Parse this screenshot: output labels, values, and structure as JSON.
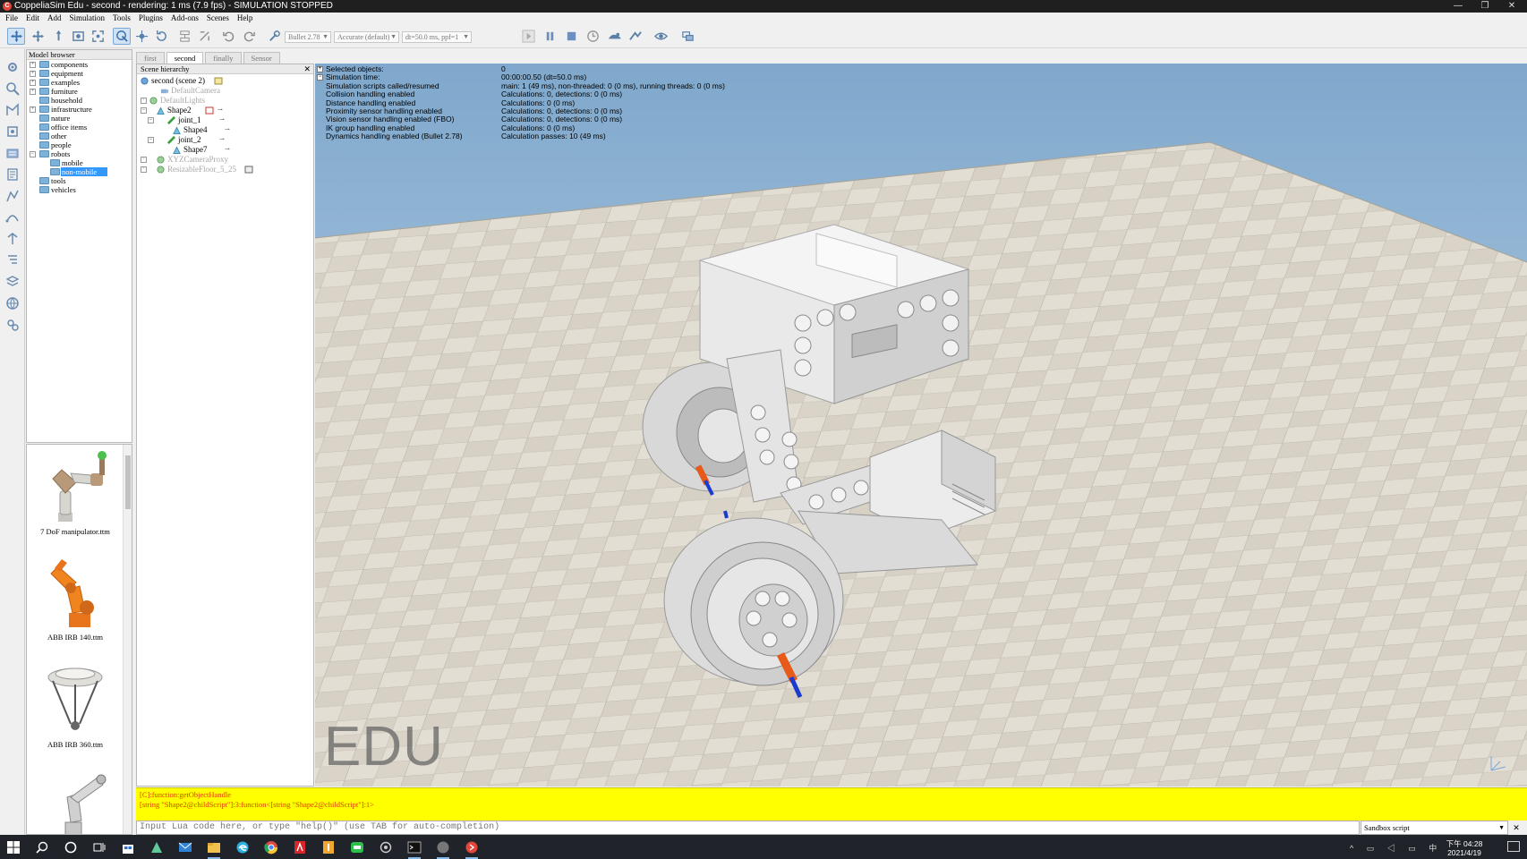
{
  "window": {
    "title": "CoppeliaSim Edu - second - rendering: 1 ms (7.9 fps) - SIMULATION STOPPED",
    "app_icon_letter": "C",
    "controls": {
      "minimize": "—",
      "restore": "❐",
      "close": "✕"
    }
  },
  "menu": [
    "File",
    "Edit",
    "Add",
    "Simulation",
    "Tools",
    "Plugins",
    "Add-ons",
    "Scenes",
    "Help"
  ],
  "toolbar": {
    "engine": "Bullet 2.78",
    "accuracy": "Accurate (default)",
    "timestep": "dt=50.0 ms, ppf=1"
  },
  "model_browser": {
    "header": "Model browser",
    "items": [
      {
        "label": "components",
        "expandable": true
      },
      {
        "label": "equipment",
        "expandable": true
      },
      {
        "label": "examples",
        "expandable": true
      },
      {
        "label": "furniture",
        "expandable": true
      },
      {
        "label": "household",
        "expandable": false
      },
      {
        "label": "infrastructure",
        "expandable": true
      },
      {
        "label": "nature",
        "expandable": false
      },
      {
        "label": "office items",
        "expandable": false
      },
      {
        "label": "other",
        "expandable": false
      },
      {
        "label": "people",
        "expandable": false
      },
      {
        "label": "robots",
        "expandable": true,
        "expanded": true
      },
      {
        "label": "mobile",
        "level": 1
      },
      {
        "label": "non-mobile",
        "level": 1,
        "selected": true
      },
      {
        "label": "tools",
        "expandable": false
      },
      {
        "label": "vehicles",
        "expandable": false
      }
    ],
    "thumbnails": [
      "7 DoF manipulator.ttm",
      "ABB IRB 140.ttm",
      "ABB IRB 360.ttm"
    ]
  },
  "scene_tabs": [
    "first",
    "second",
    "finally",
    "Sensor"
  ],
  "active_scene_tab": "second",
  "scene_hierarchy": {
    "header": "Scene hierarchy",
    "rows": [
      {
        "label": "second (scene 2)",
        "dim": false
      },
      {
        "label": "DefaultCamera",
        "dim": true
      },
      {
        "label": "DefaultLights",
        "dim": true
      },
      {
        "label": "Shape2",
        "dim": false
      },
      {
        "label": "joint_1",
        "dim": false
      },
      {
        "label": "Shape4",
        "dim": false
      },
      {
        "label": "joint_2",
        "dim": false
      },
      {
        "label": "Shape7",
        "dim": false
      },
      {
        "label": "XYZCameraProxy",
        "dim": true
      },
      {
        "label": "ResizableFloor_5_25",
        "dim": true
      }
    ]
  },
  "sim_info": [
    {
      "key": "Selected objects:",
      "value": "0",
      "toggle": true
    },
    {
      "key": "Simulation time:",
      "value": "00:00:00.50 (dt=50.0 ms)",
      "toggle": true
    },
    {
      "key": "Simulation scripts called/resumed",
      "value": "main: 1 (49 ms), non-threaded: 0 (0 ms), running threads: 0 (0 ms)"
    },
    {
      "key": "Collision handling enabled",
      "value": "Calculations: 0, detections: 0 (0 ms)"
    },
    {
      "key": "Distance handling enabled",
      "value": "Calculations: 0 (0 ms)"
    },
    {
      "key": "Proximity sensor handling enabled",
      "value": "Calculations: 0, detections: 0 (0 ms)"
    },
    {
      "key": "Vision sensor handling enabled (FBO)",
      "value": "Calculations: 0, detections: 0 (0 ms)"
    },
    {
      "key": "IK group handling enabled",
      "value": "Calculations: 0 (0 ms)"
    },
    {
      "key": "Dynamics handling enabled (Bullet 2.78)",
      "value": "Calculation passes: 10 (49 ms)"
    }
  ],
  "watermark": "EDU",
  "console": {
    "lines": [
      "[C]:function:getObjectHandle",
      "[string \"Shape2@childScript\"]:3:function<[string \"Shape2@childScript\"]:1>"
    ],
    "input_placeholder": "Input Lua code here, or type \"help()\" (use TAB for auto-completion)",
    "script_select": "Sandbox script",
    "close": "✕"
  },
  "taskbar": {
    "clock_time": "下午 04:28",
    "clock_date": "2021/4/19",
    "tray_icons": "^ ▭ ◁ ▭ 中"
  },
  "colors": {
    "sky_top": "#7fa8cc",
    "sky_bottom": "#c4d8ea",
    "console_bg": "#ffff00",
    "console_text": "#e23a00",
    "selection": "#3399ff"
  }
}
